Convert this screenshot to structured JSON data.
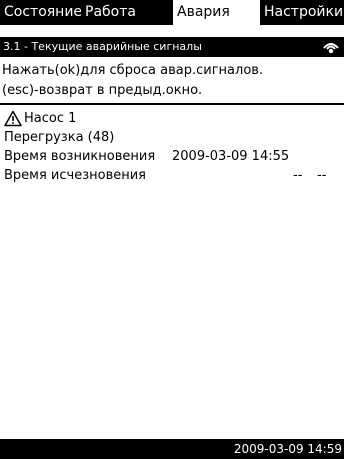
{
  "tabs": [
    {
      "label": "Состояние"
    },
    {
      "label": "Работа"
    },
    {
      "label": "Авария"
    },
    {
      "label": "Настройки"
    }
  ],
  "header": {
    "title": "3.1 - Текущие аварийные сигналы",
    "icon": "connection-icon"
  },
  "info": {
    "line1": "Нажать(ok)для сброса авар.сигналов.",
    "line2": "(esc)-возврат в предыд.окно."
  },
  "alarm": {
    "source": "Насос 1",
    "description": "Перегрузка (48)",
    "occurred_label": "Время возникновения",
    "occurred_value": "2009-03-09  14:55",
    "cleared_label": "Время исчезновения",
    "cleared_date": "--",
    "cleared_time": "--"
  },
  "footer": {
    "datetime": "2009-03-09  14:59"
  }
}
